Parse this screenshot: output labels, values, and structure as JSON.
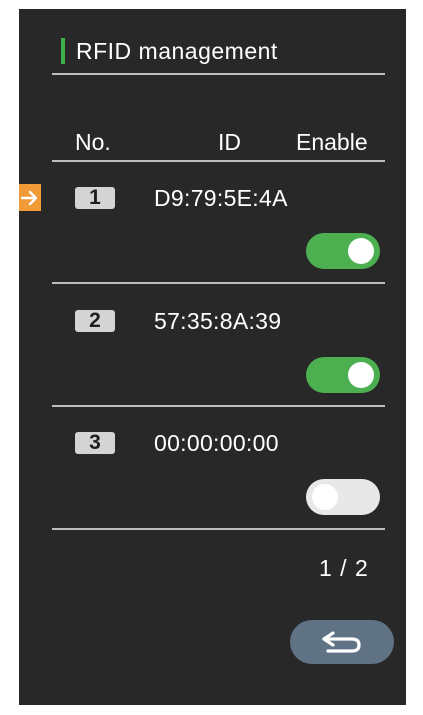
{
  "title": "RFID management",
  "columns": {
    "no": "No.",
    "id": "ID",
    "enable": "Enable"
  },
  "rows": [
    {
      "no": "1",
      "id": "D9:79:5E:4A",
      "enabled": true,
      "selected": true
    },
    {
      "no": "2",
      "id": "57:35:8A:39",
      "enabled": true,
      "selected": false
    },
    {
      "no": "3",
      "id": "00:00:00:00",
      "enabled": false,
      "selected": false
    }
  ],
  "pager": "1 / 2",
  "icons": {
    "selection": "arrow-right-icon",
    "back": "return-arrow-icon"
  },
  "colors": {
    "accent": "#3fae4a",
    "toggle_on": "#4caf50",
    "toggle_off": "#e8e8e8",
    "selector": "#f09a38",
    "back_button": "#607385",
    "background": "#282828"
  }
}
